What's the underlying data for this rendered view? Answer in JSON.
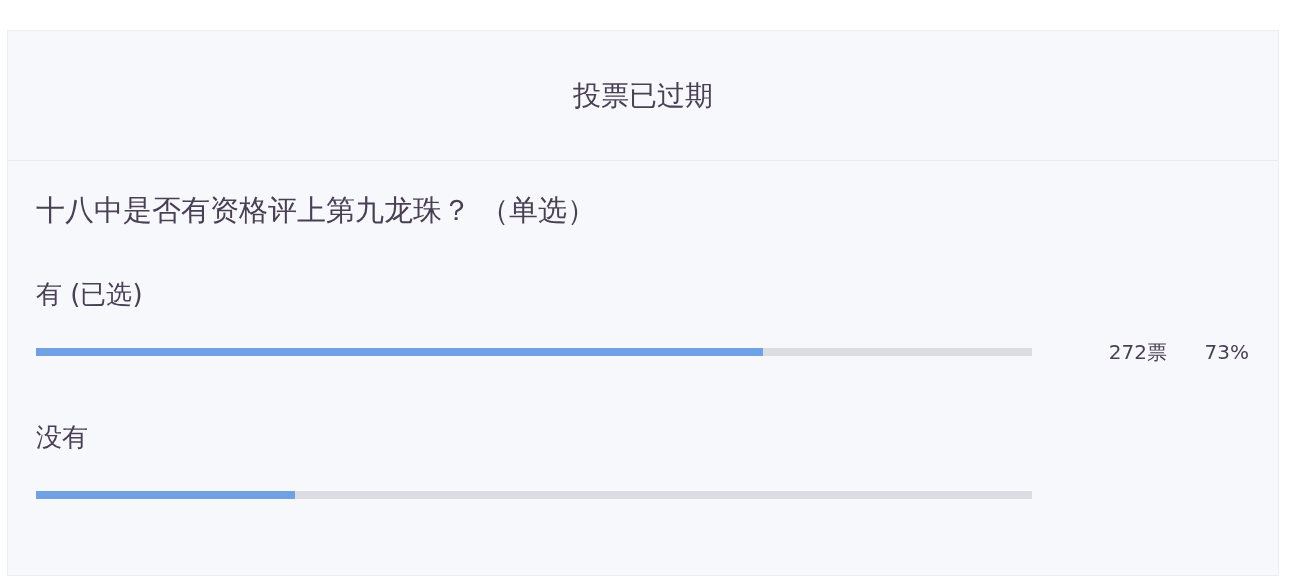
{
  "poll": {
    "status": "投票已过期",
    "question": "十八中是否有资格评上第九龙珠？ （单选）",
    "options": [
      {
        "label": "有 (已选)",
        "level": 0.73,
        "votes": "272票",
        "percent": "73%"
      },
      {
        "label": "没有",
        "level": 0.26
      }
    ]
  }
}
